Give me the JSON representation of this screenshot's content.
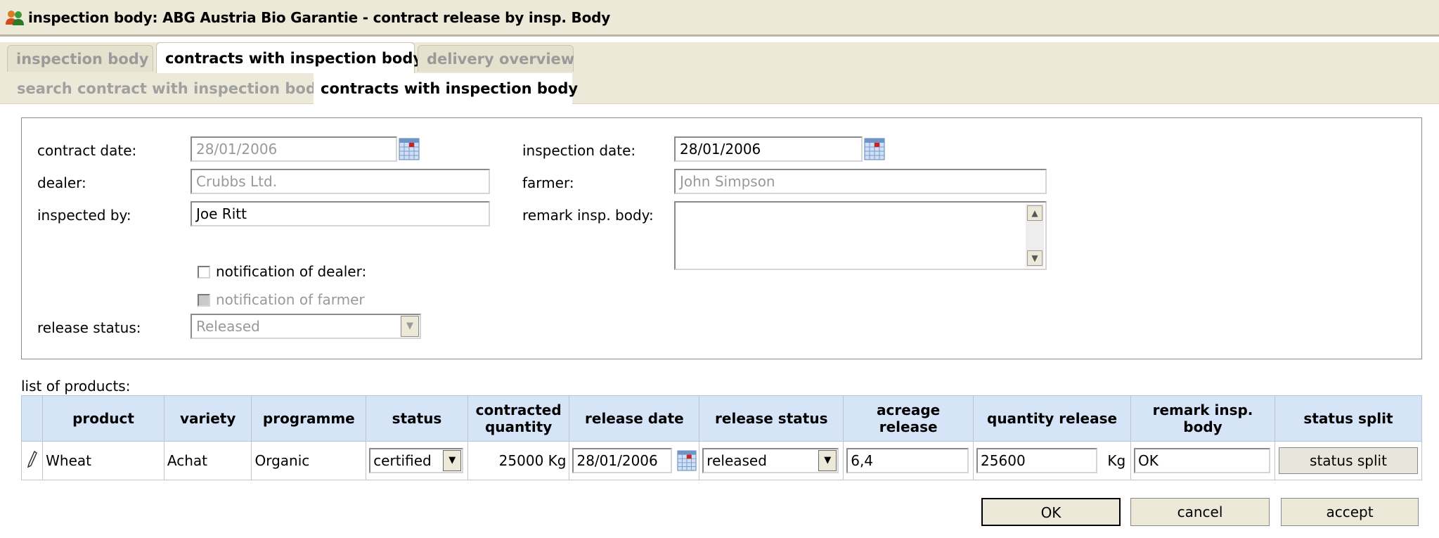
{
  "window": {
    "title": "inspection body: ABG Austria Bio Garantie - contract release by insp. Body",
    "icon": "users-icon"
  },
  "tabs": [
    {
      "label": "inspection body",
      "active": false
    },
    {
      "label": "contracts with inspection body",
      "active": true
    },
    {
      "label": "delivery overview",
      "active": false
    }
  ],
  "subtabs": [
    {
      "label": "search contract with inspection body",
      "active": false
    },
    {
      "label": "contracts with inspection body",
      "active": true
    }
  ],
  "form": {
    "contract_date": {
      "label": "contract date:",
      "value": "28/01/2006"
    },
    "inspection_date": {
      "label": "inspection date:",
      "value": "28/01/2006"
    },
    "dealer": {
      "label": "dealer:",
      "value": "Crubbs Ltd."
    },
    "farmer": {
      "label": "farmer:",
      "value": "John Simpson"
    },
    "inspected_by": {
      "label": "inspected by:",
      "value": "Joe Ritt"
    },
    "remark": {
      "label": "remark insp. body:",
      "value": ""
    },
    "notify_dealer": {
      "label": "notification of dealer:",
      "checked": false
    },
    "notify_farmer": {
      "label": "notification of farmer",
      "checked": false
    },
    "release_status": {
      "label": "release status:",
      "value": "Released"
    }
  },
  "products": {
    "label": "list of products:",
    "columns": [
      "",
      "product",
      "variety",
      "programme",
      "status",
      "contracted quantity",
      "release date",
      "release status",
      "acreage release",
      "quantity release",
      "remark insp. body",
      "status split"
    ],
    "rows": [
      {
        "product": "Wheat",
        "variety": "Achat",
        "programme": "Organic",
        "status": "certified",
        "contracted_quantity": "25000 Kg",
        "release_date": "28/01/2006",
        "release_status": "released",
        "acreage_release": "6,4",
        "quantity_release": "25600",
        "quantity_unit": "Kg",
        "remark": "OK",
        "status_split_label": "status split"
      }
    ]
  },
  "buttons": {
    "ok": "OK",
    "cancel": "cancel",
    "accept": "accept"
  },
  "colors": {
    "title_bg": "#ece9d8",
    "header_bg": "#d6e4f8"
  }
}
